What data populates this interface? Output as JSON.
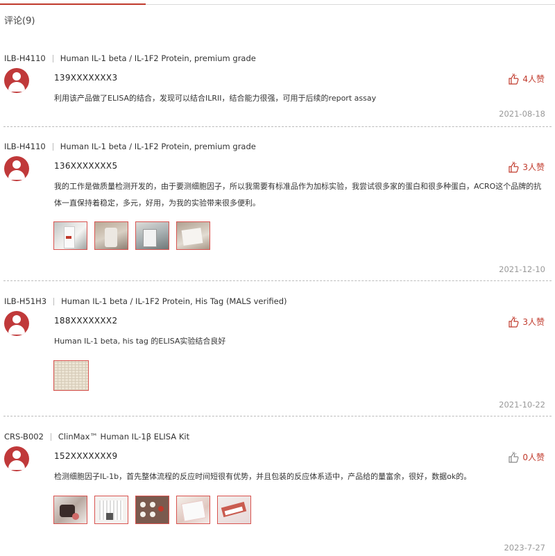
{
  "section": {
    "title": "评论(9)"
  },
  "reviews": [
    {
      "sku": "ILB-H4110",
      "product": "Human IL-1 beta / IL-1F2 Protein, premium grade",
      "user": "139XXXXXXX3",
      "likes": "4人赞",
      "text": "利用该产品做了ELISA的结合，发现可以结合ILRII，结合能力很强，可用于后续的report assay",
      "date": "2021-08-18"
    },
    {
      "sku": "ILB-H4110",
      "product": "Human IL-1 beta / IL-1F2 Protein, premium grade",
      "user": "136XXXXXXX5",
      "likes": "3人赞",
      "text": "我的工作是做质量检测开发的，由于要测细胞因子，所以我需要有标准品作为加标实验，我尝试很多家的蛋白和很多种蛋白，ACRO这个品牌的抗体一直保持着稳定，多元，好用，为我的实验带来很多便利。",
      "date": "2021-12-10"
    },
    {
      "sku": "ILB-H51H3",
      "product": "Human IL-1 beta / IL-1F2 Protein, His Tag (MALS verified)",
      "user": "188XXXXXXX2",
      "likes": "3人赞",
      "text": "Human IL-1 beta, his tag 的ELISA实验结合良好",
      "date": "2021-10-22"
    },
    {
      "sku": "CRS-B002",
      "product": "ClinMax™ Human IL-1β ELISA Kit",
      "user": "152XXXXXXX9",
      "likes": "0人赞",
      "text": "检测细胞因子IL-1b，首先整体流程的反应时间短很有优势，并且包装的反应体系适中，产品给的量富余，很好，数据ok的。",
      "date": "2023-7-27"
    }
  ],
  "colors": {
    "accent": "#c0392b",
    "muted": "#999999"
  },
  "icons": {
    "avatar": "user-avatar-icon",
    "like": "thumbs-up-icon"
  }
}
